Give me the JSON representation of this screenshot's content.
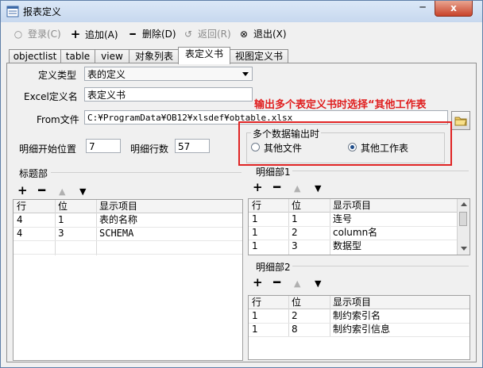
{
  "window": {
    "title": "报表定义",
    "minimize": "─",
    "close": "x"
  },
  "toolbar": {
    "login": "登录(C)",
    "add": "追加(A)",
    "delete": "删除(D)",
    "back": "返回(R)",
    "exit": "退出(X)",
    "icons": [
      "login-icon",
      "add-icon",
      "delete-icon",
      "back-icon",
      "exit-icon"
    ]
  },
  "tabs": [
    "objectlist",
    "table",
    "view",
    "对象列表",
    "表定义书",
    "视图定义书"
  ],
  "active_tab": "表定义书",
  "form": {
    "def_type_label": "定义类型",
    "def_type_value": "表的定义",
    "excel_label": "Excel定义名",
    "excel_value": "表定义书",
    "from_label": "From文件",
    "from_value": "C:¥ProgramData¥OB12¥xlsdef¥obtable.xlsx",
    "start_label": "明细开始位置",
    "start_value": "7",
    "rows_label": "明细行数",
    "rows_value": "57"
  },
  "annotation": "输出多个表定义书时选择“其他工作表",
  "output_group": {
    "label": "多个数据输出时",
    "option1": "其他文件",
    "option2": "其他工作表",
    "selected": "其他工作表"
  },
  "controls": {
    "add": "+",
    "remove": "━",
    "up": "▲",
    "down": "▼"
  },
  "title_section": {
    "label": "标题部",
    "columns": [
      "行",
      "位",
      "显示项目"
    ],
    "rows": [
      [
        "4",
        "1",
        "表的名称"
      ],
      [
        "4",
        "3",
        "SCHEMA"
      ]
    ]
  },
  "detail1": {
    "label": "明细部1",
    "columns": [
      "行",
      "位",
      "显示项目"
    ],
    "rows": [
      [
        "1",
        "1",
        "连号"
      ],
      [
        "1",
        "2",
        "column名"
      ],
      [
        "1",
        "3",
        "数据型"
      ]
    ]
  },
  "detail2": {
    "label": "明细部2",
    "columns": [
      "行",
      "位",
      "显示项目"
    ],
    "rows": [
      [
        "1",
        "2",
        "制约索引名"
      ],
      [
        "1",
        "8",
        "制约索引信息"
      ]
    ]
  }
}
